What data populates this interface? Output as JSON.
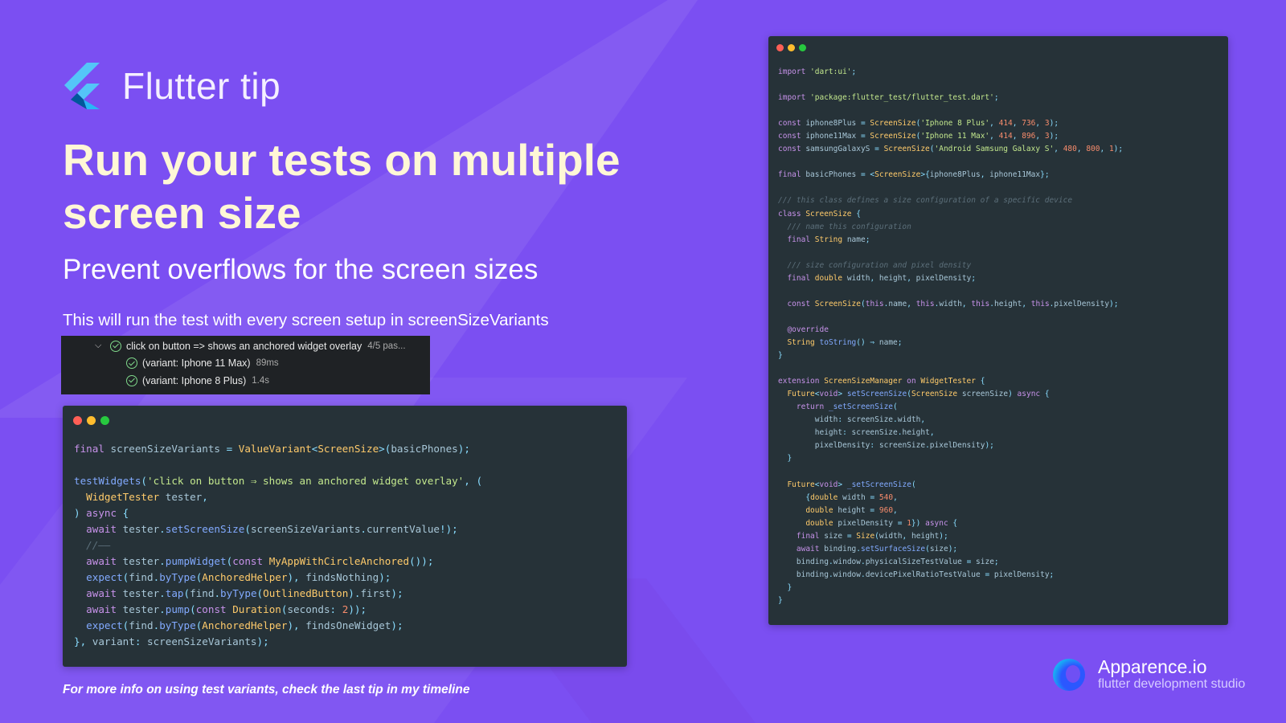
{
  "brand": {
    "logo_icon": "flutter-logo-icon",
    "title": "Flutter tip"
  },
  "headline": "Run your tests on multiple screen size",
  "subheadline": "Prevent overflows for the screen sizes",
  "description": "This will run the test with every screen setup in screenSizeVariants",
  "test_results": {
    "group": {
      "label": "click on button => shows an anchored widget overlay",
      "meta": "4/5 pas..."
    },
    "rows": [
      {
        "label": "(variant: Iphone 11 Max)",
        "meta": "89ms"
      },
      {
        "label": "(variant: Iphone 8 Plus)",
        "meta": "1.4s"
      }
    ]
  },
  "footer_note": "For more info on using test variants, check the last tip in my timeline",
  "apparence": {
    "name": "Apparence.io",
    "tagline": "flutter development studio"
  },
  "colors": {
    "background": "#7b4ff2",
    "headline": "#fff7d6",
    "code_bg": "#263238",
    "window_red": "#ff5f56",
    "window_yellow": "#ffbd2e",
    "window_green": "#27c93f"
  },
  "code_left_lines": [
    [
      [
        "k",
        "final "
      ],
      [
        "v",
        "screenSizeVariants "
      ],
      [
        "p",
        "= "
      ],
      [
        "ty",
        "ValueVariant"
      ],
      [
        "p",
        "<"
      ],
      [
        "ty",
        "ScreenSize"
      ],
      [
        "p",
        ">("
      ],
      [
        "v",
        "basicPhones"
      ],
      [
        "p",
        ");"
      ]
    ],
    [],
    [
      [
        "t",
        "testWidgets"
      ],
      [
        "p",
        "("
      ],
      [
        "s",
        "'click on button ⇒ shows an anchored widget overlay'"
      ],
      [
        "p",
        ", ("
      ]
    ],
    [
      [
        "d",
        "  "
      ],
      [
        "ty",
        "WidgetTester "
      ],
      [
        "v",
        "tester"
      ],
      [
        "p",
        ","
      ]
    ],
    [
      [
        "p",
        ") "
      ],
      [
        "k",
        "async "
      ],
      [
        "p",
        "{"
      ]
    ],
    [
      [
        "d",
        "  "
      ],
      [
        "k",
        "await "
      ],
      [
        "v",
        "tester"
      ],
      [
        "p",
        "."
      ],
      [
        "t",
        "setScreenSize"
      ],
      [
        "p",
        "("
      ],
      [
        "v",
        "screenSizeVariants"
      ],
      [
        "p",
        "."
      ],
      [
        "v",
        "currentValue"
      ],
      [
        "p",
        "!);"
      ]
    ],
    [
      [
        "c",
        "  //——"
      ]
    ],
    [
      [
        "d",
        "  "
      ],
      [
        "k",
        "await "
      ],
      [
        "v",
        "tester"
      ],
      [
        "p",
        "."
      ],
      [
        "t",
        "pumpWidget"
      ],
      [
        "p",
        "("
      ],
      [
        "k",
        "const "
      ],
      [
        "ty",
        "MyAppWithCircleAnchored"
      ],
      [
        "p",
        "());"
      ]
    ],
    [
      [
        "d",
        "  "
      ],
      [
        "t",
        "expect"
      ],
      [
        "p",
        "("
      ],
      [
        "v",
        "find"
      ],
      [
        "p",
        "."
      ],
      [
        "t",
        "byType"
      ],
      [
        "p",
        "("
      ],
      [
        "ty",
        "AnchoredHelper"
      ],
      [
        "p",
        "), "
      ],
      [
        "v",
        "findsNothing"
      ],
      [
        "p",
        ");"
      ]
    ],
    [
      [
        "d",
        "  "
      ],
      [
        "k",
        "await "
      ],
      [
        "v",
        "tester"
      ],
      [
        "p",
        "."
      ],
      [
        "t",
        "tap"
      ],
      [
        "p",
        "("
      ],
      [
        "v",
        "find"
      ],
      [
        "p",
        "."
      ],
      [
        "t",
        "byType"
      ],
      [
        "p",
        "("
      ],
      [
        "ty",
        "OutlinedButton"
      ],
      [
        "p",
        ")."
      ],
      [
        "v",
        "first"
      ],
      [
        "p",
        ");"
      ]
    ],
    [
      [
        "d",
        "  "
      ],
      [
        "k",
        "await "
      ],
      [
        "v",
        "tester"
      ],
      [
        "p",
        "."
      ],
      [
        "t",
        "pump"
      ],
      [
        "p",
        "("
      ],
      [
        "k",
        "const "
      ],
      [
        "ty",
        "Duration"
      ],
      [
        "p",
        "("
      ],
      [
        "v",
        "seconds"
      ],
      [
        "p",
        ": "
      ],
      [
        "n",
        "2"
      ],
      [
        "p",
        "));"
      ]
    ],
    [
      [
        "d",
        "  "
      ],
      [
        "t",
        "expect"
      ],
      [
        "p",
        "("
      ],
      [
        "v",
        "find"
      ],
      [
        "p",
        "."
      ],
      [
        "t",
        "byType"
      ],
      [
        "p",
        "("
      ],
      [
        "ty",
        "AnchoredHelper"
      ],
      [
        "p",
        "), "
      ],
      [
        "v",
        "findsOneWidget"
      ],
      [
        "p",
        ");"
      ]
    ],
    [
      [
        "p",
        "}, "
      ],
      [
        "v",
        "variant"
      ],
      [
        "p",
        ": "
      ],
      [
        "v",
        "screenSizeVariants"
      ],
      [
        "p",
        ");"
      ]
    ]
  ],
  "code_right_lines": [
    [
      [
        "k",
        "import "
      ],
      [
        "s",
        "'dart:ui'"
      ],
      [
        "p",
        ";"
      ]
    ],
    [],
    [
      [
        "k",
        "import "
      ],
      [
        "s",
        "'package:flutter_test/flutter_test.dart'"
      ],
      [
        "p",
        ";"
      ]
    ],
    [],
    [
      [
        "k",
        "const "
      ],
      [
        "v",
        "iphone8Plus "
      ],
      [
        "p",
        "= "
      ],
      [
        "ty",
        "ScreenSize"
      ],
      [
        "p",
        "("
      ],
      [
        "s",
        "'Iphone 8 Plus'"
      ],
      [
        "p",
        ", "
      ],
      [
        "n",
        "414"
      ],
      [
        "p",
        ", "
      ],
      [
        "n",
        "736"
      ],
      [
        "p",
        ", "
      ],
      [
        "n",
        "3"
      ],
      [
        "p",
        ");"
      ]
    ],
    [
      [
        "k",
        "const "
      ],
      [
        "v",
        "iphone11Max "
      ],
      [
        "p",
        "= "
      ],
      [
        "ty",
        "ScreenSize"
      ],
      [
        "p",
        "("
      ],
      [
        "s",
        "'Iphone 11 Max'"
      ],
      [
        "p",
        ", "
      ],
      [
        "n",
        "414"
      ],
      [
        "p",
        ", "
      ],
      [
        "n",
        "896"
      ],
      [
        "p",
        ", "
      ],
      [
        "n",
        "3"
      ],
      [
        "p",
        ");"
      ]
    ],
    [
      [
        "k",
        "const "
      ],
      [
        "v",
        "samsungGalaxyS "
      ],
      [
        "p",
        "= "
      ],
      [
        "ty",
        "ScreenSize"
      ],
      [
        "p",
        "("
      ],
      [
        "s",
        "'Android Samsung Galaxy S'"
      ],
      [
        "p",
        ", "
      ],
      [
        "n",
        "480"
      ],
      [
        "p",
        ", "
      ],
      [
        "n",
        "800"
      ],
      [
        "p",
        ", "
      ],
      [
        "n",
        "1"
      ],
      [
        "p",
        ");"
      ]
    ],
    [],
    [
      [
        "k",
        "final "
      ],
      [
        "v",
        "basicPhones "
      ],
      [
        "p",
        "= <"
      ],
      [
        "ty",
        "ScreenSize"
      ],
      [
        "p",
        ">{"
      ],
      [
        "v",
        "iphone8Plus"
      ],
      [
        "p",
        ", "
      ],
      [
        "v",
        "iphone11Max"
      ],
      [
        "p",
        "};"
      ]
    ],
    [],
    [
      [
        "c",
        "/// this class defines a size configuration of a specific device"
      ]
    ],
    [
      [
        "k",
        "class "
      ],
      [
        "ty",
        "ScreenSize "
      ],
      [
        "p",
        "{"
      ]
    ],
    [
      [
        "c",
        "  /// name this configuration"
      ]
    ],
    [
      [
        "d",
        "  "
      ],
      [
        "k",
        "final "
      ],
      [
        "ty",
        "String "
      ],
      [
        "v",
        "name"
      ],
      [
        "p",
        ";"
      ]
    ],
    [],
    [
      [
        "c",
        "  /// size configuration and pixel density"
      ]
    ],
    [
      [
        "d",
        "  "
      ],
      [
        "k",
        "final "
      ],
      [
        "ty",
        "double "
      ],
      [
        "v",
        "width"
      ],
      [
        "p",
        ", "
      ],
      [
        "v",
        "height"
      ],
      [
        "p",
        ", "
      ],
      [
        "v",
        "pixelDensity"
      ],
      [
        "p",
        ";"
      ]
    ],
    [],
    [
      [
        "d",
        "  "
      ],
      [
        "k",
        "const "
      ],
      [
        "ty",
        "ScreenSize"
      ],
      [
        "p",
        "("
      ],
      [
        "k",
        "this"
      ],
      [
        "p",
        "."
      ],
      [
        "v",
        "name"
      ],
      [
        "p",
        ", "
      ],
      [
        "k",
        "this"
      ],
      [
        "p",
        "."
      ],
      [
        "v",
        "width"
      ],
      [
        "p",
        ", "
      ],
      [
        "k",
        "this"
      ],
      [
        "p",
        "."
      ],
      [
        "v",
        "height"
      ],
      [
        "p",
        ", "
      ],
      [
        "k",
        "this"
      ],
      [
        "p",
        "."
      ],
      [
        "v",
        "pixelDensity"
      ],
      [
        "p",
        ");"
      ]
    ],
    [],
    [
      [
        "d",
        "  "
      ],
      [
        "k",
        "@override"
      ]
    ],
    [
      [
        "d",
        "  "
      ],
      [
        "ty",
        "String "
      ],
      [
        "t",
        "toString"
      ],
      [
        "p",
        "() ⇒ "
      ],
      [
        "v",
        "name"
      ],
      [
        "p",
        ";"
      ]
    ],
    [
      [
        "p",
        "}"
      ]
    ],
    [],
    [
      [
        "k",
        "extension "
      ],
      [
        "ty",
        "ScreenSizeManager "
      ],
      [
        "k",
        "on "
      ],
      [
        "ty",
        "WidgetTester "
      ],
      [
        "p",
        "{"
      ]
    ],
    [
      [
        "d",
        "  "
      ],
      [
        "ty",
        "Future"
      ],
      [
        "p",
        "<"
      ],
      [
        "k",
        "void"
      ],
      [
        "p",
        "> "
      ],
      [
        "t",
        "setScreenSize"
      ],
      [
        "p",
        "("
      ],
      [
        "ty",
        "ScreenSize "
      ],
      [
        "v",
        "screenSize"
      ],
      [
        "p",
        ") "
      ],
      [
        "k",
        "async "
      ],
      [
        "p",
        "{"
      ]
    ],
    [
      [
        "d",
        "    "
      ],
      [
        "k",
        "return "
      ],
      [
        "t",
        "_setScreenSize"
      ],
      [
        "p",
        "("
      ]
    ],
    [
      [
        "d",
        "        "
      ],
      [
        "v",
        "width"
      ],
      [
        "p",
        ": "
      ],
      [
        "v",
        "screenSize"
      ],
      [
        "p",
        "."
      ],
      [
        "v",
        "width"
      ],
      [
        "p",
        ","
      ]
    ],
    [
      [
        "d",
        "        "
      ],
      [
        "v",
        "height"
      ],
      [
        "p",
        ": "
      ],
      [
        "v",
        "screenSize"
      ],
      [
        "p",
        "."
      ],
      [
        "v",
        "height"
      ],
      [
        "p",
        ","
      ]
    ],
    [
      [
        "d",
        "        "
      ],
      [
        "v",
        "pixelDensity"
      ],
      [
        "p",
        ": "
      ],
      [
        "v",
        "screenSize"
      ],
      [
        "p",
        "."
      ],
      [
        "v",
        "pixelDensity"
      ],
      [
        "p",
        ");"
      ]
    ],
    [
      [
        "d",
        "  "
      ],
      [
        "p",
        "}"
      ]
    ],
    [],
    [
      [
        "d",
        "  "
      ],
      [
        "ty",
        "Future"
      ],
      [
        "p",
        "<"
      ],
      [
        "k",
        "void"
      ],
      [
        "p",
        "> "
      ],
      [
        "t",
        "_setScreenSize"
      ],
      [
        "p",
        "("
      ]
    ],
    [
      [
        "d",
        "      "
      ],
      [
        "p",
        "{"
      ],
      [
        "ty",
        "double "
      ],
      [
        "v",
        "width "
      ],
      [
        "p",
        "= "
      ],
      [
        "n",
        "540"
      ],
      [
        "p",
        ","
      ]
    ],
    [
      [
        "d",
        "      "
      ],
      [
        "ty",
        "double "
      ],
      [
        "v",
        "height "
      ],
      [
        "p",
        "= "
      ],
      [
        "n",
        "960"
      ],
      [
        "p",
        ","
      ]
    ],
    [
      [
        "d",
        "      "
      ],
      [
        "ty",
        "double "
      ],
      [
        "v",
        "pixelDensity "
      ],
      [
        "p",
        "= "
      ],
      [
        "n",
        "1"
      ],
      [
        "p",
        "}) "
      ],
      [
        "k",
        "async "
      ],
      [
        "p",
        "{"
      ]
    ],
    [
      [
        "d",
        "    "
      ],
      [
        "k",
        "final "
      ],
      [
        "v",
        "size "
      ],
      [
        "p",
        "= "
      ],
      [
        "ty",
        "Size"
      ],
      [
        "p",
        "("
      ],
      [
        "v",
        "width"
      ],
      [
        "p",
        ", "
      ],
      [
        "v",
        "height"
      ],
      [
        "p",
        ");"
      ]
    ],
    [
      [
        "d",
        "    "
      ],
      [
        "k",
        "await "
      ],
      [
        "v",
        "binding"
      ],
      [
        "p",
        "."
      ],
      [
        "t",
        "setSurfaceSize"
      ],
      [
        "p",
        "("
      ],
      [
        "v",
        "size"
      ],
      [
        "p",
        ");"
      ]
    ],
    [
      [
        "d",
        "    "
      ],
      [
        "v",
        "binding"
      ],
      [
        "p",
        "."
      ],
      [
        "v",
        "window"
      ],
      [
        "p",
        "."
      ],
      [
        "v",
        "physicalSizeTestValue "
      ],
      [
        "p",
        "= "
      ],
      [
        "v",
        "size"
      ],
      [
        "p",
        ";"
      ]
    ],
    [
      [
        "d",
        "    "
      ],
      [
        "v",
        "binding"
      ],
      [
        "p",
        "."
      ],
      [
        "v",
        "window"
      ],
      [
        "p",
        "."
      ],
      [
        "v",
        "devicePixelRatioTestValue "
      ],
      [
        "p",
        "= "
      ],
      [
        "v",
        "pixelDensity"
      ],
      [
        "p",
        ";"
      ]
    ],
    [
      [
        "d",
        "  "
      ],
      [
        "p",
        "}"
      ]
    ],
    [
      [
        "p",
        "}"
      ]
    ]
  ]
}
